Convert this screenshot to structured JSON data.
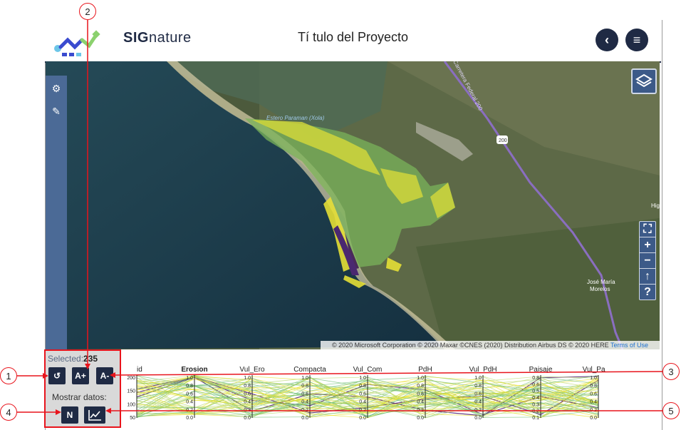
{
  "header": {
    "logo_text": "SIGnature",
    "logo_bold": "SIG",
    "logo_rest": "nature",
    "title": "Tí tulo del Proyecto",
    "back_icon": "chevron-left-icon",
    "menu_icon": "hamburger-menu-icon"
  },
  "map": {
    "place_label_1": "Estero Paraman (Xola)",
    "road_label": "Carretera Federal 200",
    "road_shield": "200",
    "town_label_1": "José María",
    "town_label_2": "Morelos",
    "edge_label": "Hig Bla",
    "attribution": "© 2020 Microsoft Corporation © 2020 Maxar ©CNES (2020) Distribution Airbus DS © 2020 HERE",
    "terms_link": "Terms of Use",
    "zoom_controls": [
      "fullscreen-icon",
      "zoom-in-icon",
      "zoom-out-icon",
      "home-extent-icon",
      "help-icon"
    ],
    "zoom_glyphs": [
      "⛶",
      "+",
      "−",
      "↑",
      "?"
    ]
  },
  "sidebar": {
    "icons": [
      "gears-icon",
      "paint-brush-icon"
    ]
  },
  "controls": {
    "selected_label": "Selected:",
    "selected_count": "235",
    "reset_label": "↺",
    "font_increase_label": "A+",
    "font_decrease_label": "A-",
    "show_data_label": "Mostrar datos:",
    "n_button_label": "N",
    "chart_button_label": "chart"
  },
  "callouts": [
    "1",
    "2",
    "3",
    "4",
    "5"
  ],
  "parallel_coords": {
    "axes": [
      "id",
      "Erosion",
      "Vul_Ero",
      "Compacta",
      "Vul_Com",
      "PdH",
      "Vul_PdH",
      "Paisaje",
      "Vul_Paisa"
    ],
    "id_ticks": [
      "200",
      "150",
      "100",
      "50"
    ],
    "value_ticks": [
      "1.0",
      "0.8",
      "0.6",
      "0.4",
      "0.2",
      "0.0"
    ],
    "paisaje_ticks": [
      "0.8",
      "0.6",
      "0.5",
      "0.4",
      "0.3",
      "0.2",
      "0.1"
    ],
    "colors": {
      "high": "#5a2a78",
      "mid": "#6fbf73",
      "low": "#e8e020",
      "light": "#b9d96a"
    }
  }
}
